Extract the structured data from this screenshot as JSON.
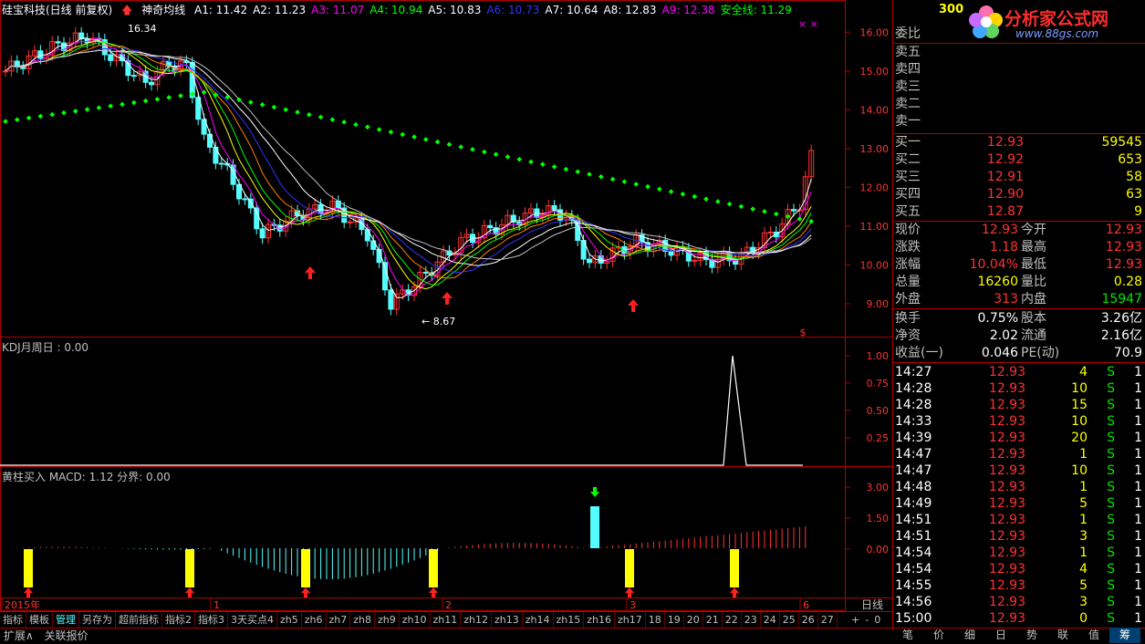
{
  "stock": {
    "name": "硅宝科技(日线 前复权)",
    "code": "300"
  },
  "legend": {
    "indicator": "神奇均线",
    "items": [
      {
        "label": "A1: 11.42",
        "color": "#ffffff"
      },
      {
        "label": "A2: 11.23",
        "color": "#ffffff"
      },
      {
        "label": "A3: 11.07",
        "color": "#ff00ff"
      },
      {
        "label": "A4: 10.94",
        "color": "#00ff00"
      },
      {
        "label": "A5: 10.83",
        "color": "#ffffff"
      },
      {
        "label": "A6: 10.73",
        "color": "#3232ff"
      },
      {
        "label": "A7: 10.64",
        "color": "#ffffff"
      },
      {
        "label": "A8: 12.83",
        "color": "#ffffff"
      },
      {
        "label": "A9: 12.38",
        "color": "#ff00ff"
      },
      {
        "label": "安全线: 11.29",
        "color": "#00ff00"
      }
    ]
  },
  "main_chart": {
    "y_ticks": [
      "16.00",
      "15.00",
      "14.00",
      "13.00",
      "12.00",
      "11.00",
      "10.00",
      "9.00"
    ],
    "high_label": "16.34",
    "low_label": "8.67"
  },
  "kdj": {
    "title": "KDJ月周日 : 0.00",
    "y_ticks": [
      "1.00",
      "0.75",
      "0.50",
      "0.25"
    ]
  },
  "macd": {
    "title": "黄柱买入  MACD: 1.12  分界: 0.00",
    "y_ticks": [
      "3.00",
      "1.50",
      "0.00"
    ]
  },
  "x_axis": {
    "labels": [
      "2015年",
      "1",
      "2",
      "3",
      "6"
    ]
  },
  "watermark": {
    "text": "分析家公式网",
    "url": "www.88gs.com"
  },
  "panel": {
    "wei_bi": "委比",
    "sells": [
      {
        "label": "卖五",
        "price": "",
        "vol": ""
      },
      {
        "label": "卖四",
        "price": "",
        "vol": ""
      },
      {
        "label": "卖三",
        "price": "",
        "vol": ""
      },
      {
        "label": "卖二",
        "price": "",
        "vol": ""
      },
      {
        "label": "卖一",
        "price": "",
        "vol": ""
      }
    ],
    "buys": [
      {
        "label": "买一",
        "price": "12.93",
        "vol": "59545"
      },
      {
        "label": "买二",
        "price": "12.92",
        "vol": "653"
      },
      {
        "label": "买三",
        "price": "12.91",
        "vol": "58"
      },
      {
        "label": "买四",
        "price": "12.90",
        "vol": "63"
      },
      {
        "label": "买五",
        "price": "12.87",
        "vol": "9"
      }
    ],
    "quote": [
      {
        "l1": "现价",
        "v1": "12.93",
        "l2": "今开",
        "v2": "12.93"
      },
      {
        "l1": "涨跌",
        "v1": "1.18",
        "l2": "最高",
        "v2": "12.93"
      },
      {
        "l1": "涨幅",
        "v1": "10.04%",
        "l2": "最低",
        "v2": "12.93"
      },
      {
        "l1": "总量",
        "v1": "16260",
        "l2": "量比",
        "v2": "0.28"
      },
      {
        "l1": "外盘",
        "v1": "313",
        "l2": "内盘",
        "v2": "15947"
      }
    ],
    "fund": [
      {
        "l1": "换手",
        "v1": "0.75%",
        "l2": "股本",
        "v2": "3.26亿"
      },
      {
        "l1": "净资",
        "v1": "2.02",
        "l2": "流通",
        "v2": "2.16亿"
      },
      {
        "l1": "收益(一)",
        "v1": "0.046",
        "l2": "PE(动)",
        "v2": "70.9"
      }
    ],
    "ticks": [
      {
        "time": "14:27",
        "price": "12.93",
        "vol": "4",
        "side": "S",
        "n": "1"
      },
      {
        "time": "14:28",
        "price": "12.93",
        "vol": "10",
        "side": "S",
        "n": "1"
      },
      {
        "time": "14:28",
        "price": "12.93",
        "vol": "15",
        "side": "S",
        "n": "1"
      },
      {
        "time": "14:33",
        "price": "12.93",
        "vol": "10",
        "side": "S",
        "n": "1"
      },
      {
        "time": "14:39",
        "price": "12.93",
        "vol": "20",
        "side": "S",
        "n": "1"
      },
      {
        "time": "14:47",
        "price": "12.93",
        "vol": "1",
        "side": "S",
        "n": "1"
      },
      {
        "time": "14:47",
        "price": "12.93",
        "vol": "10",
        "side": "S",
        "n": "1"
      },
      {
        "time": "14:48",
        "price": "12.93",
        "vol": "1",
        "side": "S",
        "n": "1"
      },
      {
        "time": "14:49",
        "price": "12.93",
        "vol": "5",
        "side": "S",
        "n": "1"
      },
      {
        "time": "14:51",
        "price": "12.93",
        "vol": "1",
        "side": "S",
        "n": "1"
      },
      {
        "time": "14:51",
        "price": "12.93",
        "vol": "3",
        "side": "S",
        "n": "1"
      },
      {
        "time": "14:54",
        "price": "12.93",
        "vol": "1",
        "side": "S",
        "n": "1"
      },
      {
        "time": "14:54",
        "price": "12.93",
        "vol": "4",
        "side": "S",
        "n": "1"
      },
      {
        "time": "14:55",
        "price": "12.93",
        "vol": "5",
        "side": "S",
        "n": "1"
      },
      {
        "time": "14:56",
        "price": "12.93",
        "vol": "3",
        "side": "S",
        "n": "1"
      },
      {
        "time": "15:00",
        "price": "12.93",
        "vol": "0",
        "side": "S",
        "n": "1"
      }
    ]
  },
  "tabs": [
    "指标",
    "模板",
    "管理",
    "另存为",
    "超前指标",
    "指标2",
    "指标3",
    "3天买点4",
    "zh5",
    "zh6",
    "zh7",
    "zh8",
    "zh9",
    "zh10",
    "zh11",
    "zh12",
    "zh13",
    "zh14",
    "zh15",
    "zh16",
    "zh17",
    "18",
    "19",
    "20",
    "21",
    "22",
    "23",
    "24",
    "25",
    "26",
    "27"
  ],
  "period": "日线",
  "bottom": [
    "扩展∧",
    "关联报价"
  ],
  "right_tabs": [
    "笔",
    "价",
    "细",
    "日",
    "势",
    "联",
    "值",
    "筹"
  ]
}
